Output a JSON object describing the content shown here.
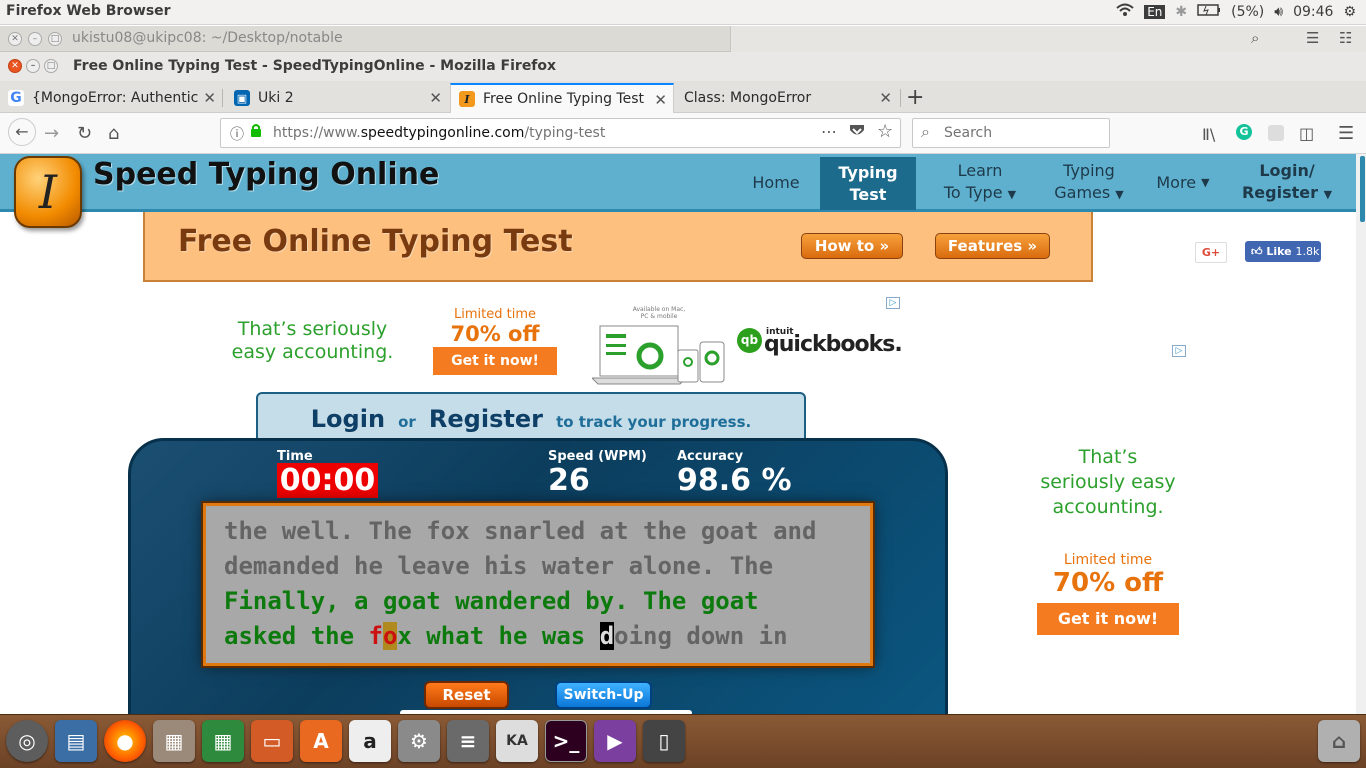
{
  "top_panel": {
    "app_title": "Firefox Web Browser",
    "lang": "En",
    "battery": "(5%)",
    "time": "09:46"
  },
  "terminal_window": {
    "title": "ukistu08@ukipc08: ~/Desktop/notable"
  },
  "firefox": {
    "window_title": "Free Online Typing Test - SpeedTypingOnline - Mozilla Firefox",
    "tabs": [
      {
        "label": "{MongoError: Authentic",
        "icon": "google-icon"
      },
      {
        "label": "Uki 2",
        "icon": "trello-icon"
      },
      {
        "label": "Free Online Typing Test",
        "icon": "speedtyping-icon"
      },
      {
        "label": "Class: MongoError",
        "icon": "none"
      }
    ],
    "url_prefix": "https://www.",
    "url_domain": "speedtypingonline.com",
    "url_path": "/typing-test",
    "search_placeholder": "Search"
  },
  "site": {
    "logo_letter": "I",
    "logo_text": "Speed Typing Online",
    "menu": [
      {
        "label": "Home"
      },
      {
        "label": "Typing Test",
        "active": true
      },
      {
        "label": "Learn To Type",
        "line1": "Learn",
        "line2": "To Type"
      },
      {
        "label": "Typing Games",
        "line1": "Typing",
        "line2": "Games"
      },
      {
        "label": "More"
      },
      {
        "label": "Login/ Register",
        "line1": "Login/",
        "line2": "Register"
      }
    ],
    "banner_title": "Free Online Typing Test",
    "howto_label": "How to »",
    "features_label": "Features »",
    "gplus_label": "G+",
    "fb_like_label": "Like",
    "fb_like_count": "1.8k"
  },
  "ads": {
    "top": {
      "tagline_line1": "That’s seriously",
      "tagline_line2": "easy accounting.",
      "limited": "Limited time",
      "offer": "70% off",
      "cta": "Get it now!",
      "available": "Available on Mac, PC & mobile",
      "brand_small": "intuit",
      "brand": "quickbooks."
    },
    "side": {
      "tagline_line1": "That’s",
      "tagline_line2": "seriously easy",
      "tagline_line3": "accounting.",
      "limited": "Limited time",
      "offer": "70% off",
      "cta": "Get it now!"
    }
  },
  "login_panel": {
    "login": "Login",
    "or": "or",
    "register": "Register",
    "suffix": "to track your progress."
  },
  "typing": {
    "time_label": "Time",
    "time_value": "00:00",
    "speed_label": "Speed (WPM)",
    "speed_value": "26",
    "accuracy_label": "Accuracy",
    "accuracy_value": "98.6 %",
    "line1": "the well. The fox snarled at the goat and",
    "line2": "demanded he leave his water alone. The",
    "line3": "Finally, a goat wandered by. The goat",
    "line4_typed": "asked the ",
    "line4_err1": "f",
    "line4_err2": "o",
    "line4_typed2": "x what he was ",
    "line4_caret": "d",
    "line4_rest": "oing down in",
    "reset_label": "Reset",
    "switch_label": "Switch-Up"
  },
  "dock_icons": [
    "ubuntu-dash-icon",
    "image-viewer-icon",
    "firefox-icon",
    "file-manager-icon",
    "spreadsheet-icon",
    "presentation-icon",
    "software-center-icon",
    "amazon-icon",
    "system-settings-icon",
    "mixer-icon",
    "keyboard-icon",
    "terminal-icon",
    "video-icon",
    "phone-icon",
    "trash-icon"
  ],
  "colors": {
    "header_blue": "#5fb0cf",
    "active_menu": "#1d6b8c",
    "banner_orange": "#fdc07f",
    "timer_red": "#e00000",
    "typed_green": "#0c7a0c"
  }
}
